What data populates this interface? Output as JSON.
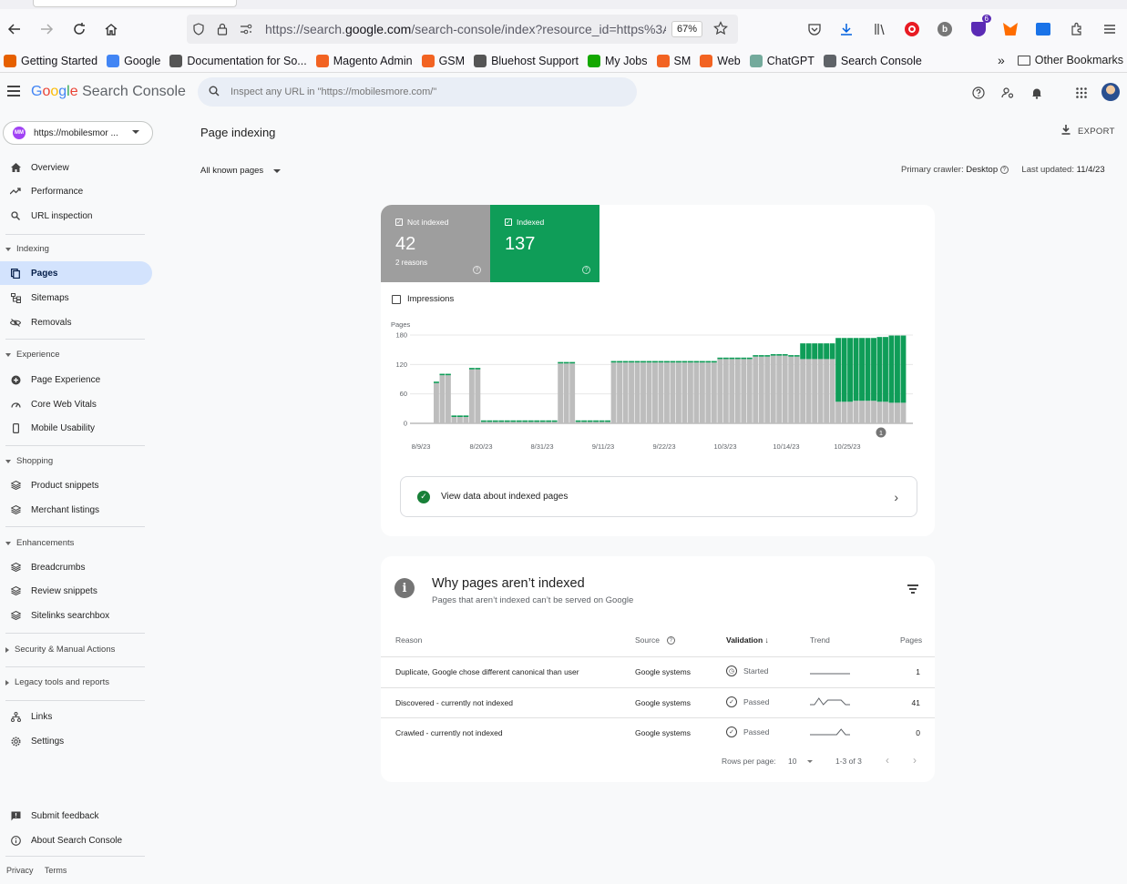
{
  "browser": {
    "url_prefix": "https://search.",
    "url_domain": "google.com",
    "url_rest": "/search-console/index?resource_id=https%3A",
    "zoom": "67%",
    "download_badge": "6",
    "bookmarks": [
      {
        "label": "Getting Started",
        "color": "#e66000"
      },
      {
        "label": "Google",
        "color": "#4285f4"
      },
      {
        "label": "Documentation for So...",
        "color": "#555555"
      },
      {
        "label": "Magento Admin",
        "color": "#f26322"
      },
      {
        "label": "GSM",
        "color": "#f26322"
      },
      {
        "label": "Bluehost Support",
        "color": "#555555"
      },
      {
        "label": "My Jobs",
        "color": "#14a800"
      },
      {
        "label": "SM",
        "color": "#f26322"
      },
      {
        "label": "Web",
        "color": "#f26322"
      },
      {
        "label": "ChatGPT",
        "color": "#74aa9c"
      },
      {
        "label": "Search Console",
        "color": "#5f6368"
      }
    ],
    "other_bookmarks": "Other Bookmarks"
  },
  "header": {
    "logo_google": [
      "G",
      "o",
      "o",
      "g",
      "l",
      "e"
    ],
    "logo_product": "Search Console",
    "search_placeholder": "Inspect any URL in \"https://mobilesmore.com/\""
  },
  "sidebar": {
    "property": "https://mobilesmor ...",
    "property_icon_text": "MM",
    "items_top": [
      {
        "label": "Overview"
      },
      {
        "label": "Performance"
      },
      {
        "label": "URL inspection"
      }
    ],
    "sections": {
      "indexing": "Indexing",
      "experience": "Experience",
      "shopping": "Shopping",
      "enhancements": "Enhancements",
      "security": "Security & Manual Actions",
      "legacy": "Legacy tools and reports"
    },
    "indexing_items": [
      {
        "label": "Pages"
      },
      {
        "label": "Sitemaps"
      },
      {
        "label": "Removals"
      }
    ],
    "experience_items": [
      {
        "label": "Page Experience"
      },
      {
        "label": "Core Web Vitals"
      },
      {
        "label": "Mobile Usability"
      }
    ],
    "shopping_items": [
      {
        "label": "Product snippets"
      },
      {
        "label": "Merchant listings"
      }
    ],
    "enhancements_items": [
      {
        "label": "Breadcrumbs"
      },
      {
        "label": "Review snippets"
      },
      {
        "label": "Sitelinks searchbox"
      }
    ],
    "bottom_items": [
      {
        "label": "Links"
      },
      {
        "label": "Settings"
      }
    ],
    "feedback_items": [
      {
        "label": "Submit feedback"
      },
      {
        "label": "About Search Console"
      }
    ],
    "footer": {
      "privacy": "Privacy",
      "terms": "Terms"
    }
  },
  "main": {
    "title": "Page indexing",
    "export": "EXPORT",
    "filter": "All known pages",
    "crawler_label": "Primary crawler:",
    "crawler_value": "Desktop",
    "updated_label": "Last updated:",
    "updated_value": "11/4/23"
  },
  "summary": {
    "not_indexed_label": "Not indexed",
    "not_indexed_value": "42",
    "not_indexed_sub": "2 reasons",
    "indexed_label": "Indexed",
    "indexed_value": "137",
    "impressions_label": "Impressions",
    "view_data": "View data about indexed pages"
  },
  "chart_data": {
    "type": "bar",
    "stacked": true,
    "ylabel": "Pages",
    "ylim": [
      0,
      180
    ],
    "yticks": [
      0,
      60,
      120,
      180
    ],
    "xticks": [
      "8/9/23",
      "8/20/23",
      "8/31/23",
      "9/11/23",
      "9/22/23",
      "10/3/23",
      "10/14/23",
      "10/25/23"
    ],
    "annotation": "1",
    "colors": {
      "not_indexed": "#bdbdbd",
      "indexed": "#0f9d58"
    },
    "series": [
      {
        "name": "Not indexed",
        "values": [
          82,
          98,
          98,
          13,
          13,
          13,
          110,
          110,
          3,
          3,
          3,
          3,
          3,
          3,
          3,
          3,
          3,
          3,
          3,
          3,
          3,
          122,
          122,
          122,
          3,
          3,
          3,
          3,
          3,
          3,
          124,
          124,
          124,
          124,
          124,
          124,
          124,
          124,
          124,
          124,
          124,
          124,
          124,
          124,
          124,
          124,
          124,
          124,
          131,
          131,
          131,
          131,
          131,
          131,
          136,
          136,
          136,
          138,
          138,
          138,
          136,
          136,
          131,
          131,
          131,
          131,
          131,
          131,
          44,
          44,
          44,
          46,
          46,
          46,
          46,
          44,
          44,
          42,
          42,
          42
        ]
      },
      {
        "name": "Indexed",
        "values": [
          3,
          3,
          3,
          3,
          3,
          3,
          3,
          3,
          3,
          3,
          3,
          3,
          3,
          3,
          3,
          3,
          3,
          3,
          3,
          3,
          3,
          3,
          3,
          3,
          3,
          3,
          3,
          3,
          3,
          3,
          3,
          3,
          3,
          3,
          3,
          3,
          3,
          3,
          3,
          3,
          3,
          3,
          3,
          3,
          3,
          3,
          3,
          3,
          3,
          3,
          3,
          3,
          3,
          3,
          3,
          3,
          3,
          3,
          3,
          3,
          3,
          3,
          32,
          32,
          32,
          32,
          32,
          32,
          130,
          130,
          130,
          128,
          128,
          128,
          128,
          132,
          132,
          137,
          137,
          137
        ]
      }
    ]
  },
  "why": {
    "title": "Why pages aren’t indexed",
    "subtitle": "Pages that aren’t indexed can’t be served on Google",
    "columns": {
      "reason": "Reason",
      "source": "Source",
      "validation": "Validation",
      "trend": "Trend",
      "pages": "Pages"
    },
    "rows": [
      {
        "reason": "Duplicate, Google chose different canonical than user",
        "source": "Google systems",
        "validation": "Started",
        "pages": "1",
        "trend": [
          1,
          1,
          1,
          1,
          1,
          1,
          1,
          1,
          1,
          1
        ]
      },
      {
        "reason": "Discovered - currently not indexed",
        "source": "Google systems",
        "validation": "Passed",
        "pages": "41",
        "trend": [
          1,
          1,
          8,
          1,
          6,
          6,
          6,
          6,
          1,
          1
        ]
      },
      {
        "reason": "Crawled - currently not indexed",
        "source": "Google systems",
        "validation": "Passed",
        "pages": "0",
        "trend": [
          1,
          1,
          1,
          1,
          1,
          1,
          1,
          7,
          1,
          1
        ]
      }
    ],
    "rows_per_page_label": "Rows per page:",
    "rows_per_page": "10",
    "range": "1-3 of 3"
  }
}
